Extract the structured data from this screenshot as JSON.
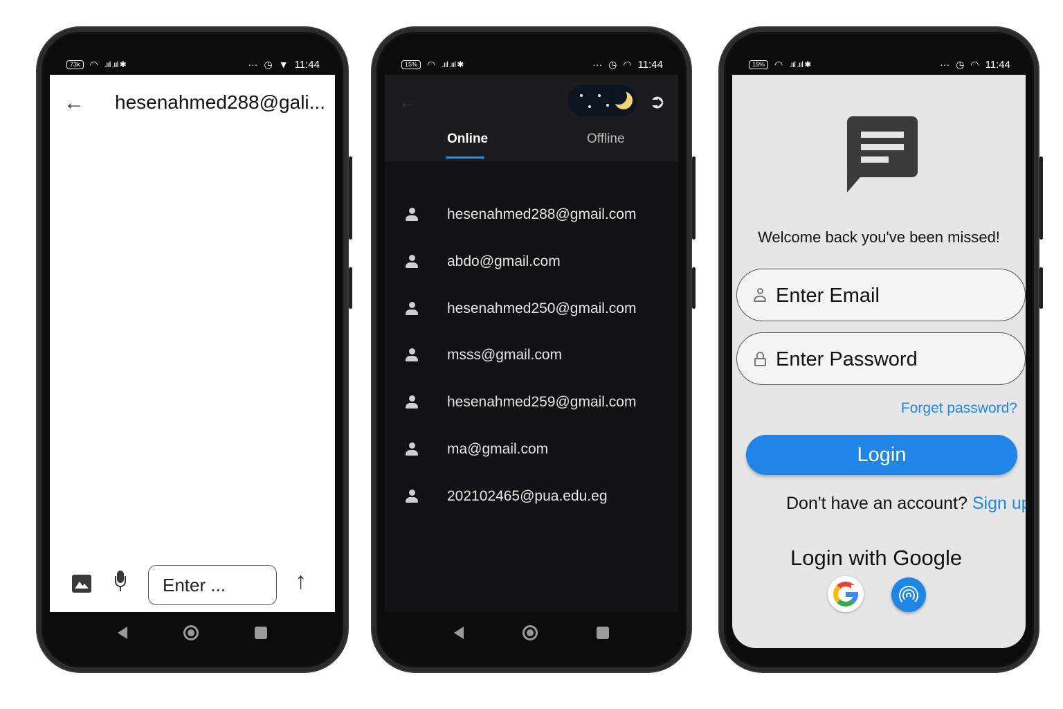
{
  "status_bar": {
    "phone1_battery": "73k",
    "phone2_battery": "15%",
    "phone3_battery": "15%",
    "signal": ".ııl .ııl ✱",
    "more": "···",
    "time": "11:44"
  },
  "chat_screen": {
    "title": "hesenahmed288@gali...",
    "input_placeholder": "Enter ..."
  },
  "users_screen": {
    "tabs": [
      {
        "label": "Online",
        "active": true
      },
      {
        "label": "Offline",
        "active": false
      }
    ],
    "users": [
      "hesenahmed288@gmail.com",
      "abdo@gmail.com",
      "hesenahmed250@gmail.com",
      "msss@gmail.com",
      "hesenahmed259@gmail.com",
      "ma@gmail.com",
      "202102465@pua.edu.eg"
    ]
  },
  "login_screen": {
    "welcome": "Welcome back you've been missed!",
    "email_placeholder": "Enter Email",
    "password_placeholder": "Enter Password",
    "forgot": "Forget password?",
    "login_button": "Login",
    "no_account": "Don't have an account? ",
    "sign_up": "Sign up",
    "google_title": "Login with Google"
  },
  "colors": {
    "accent": "#1f86e8",
    "dark_bg": "#121214",
    "light_bg": "#e6e6e6"
  }
}
